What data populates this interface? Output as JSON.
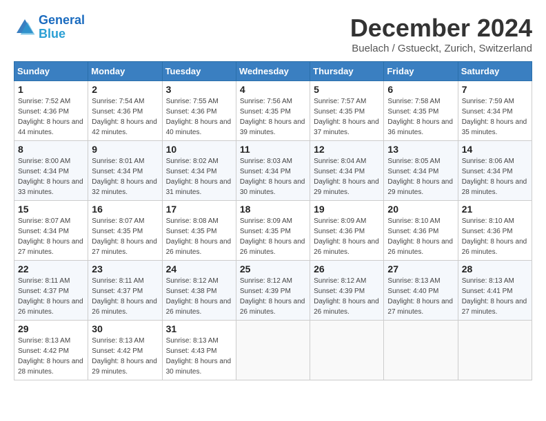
{
  "header": {
    "logo_line1": "General",
    "logo_line2": "Blue",
    "month_title": "December 2024",
    "subtitle": "Buelach / Gstueckt, Zurich, Switzerland"
  },
  "weekdays": [
    "Sunday",
    "Monday",
    "Tuesday",
    "Wednesday",
    "Thursday",
    "Friday",
    "Saturday"
  ],
  "weeks": [
    [
      {
        "day": "1",
        "sunrise": "7:52 AM",
        "sunset": "4:36 PM",
        "daylight": "8 hours and 44 minutes."
      },
      {
        "day": "2",
        "sunrise": "7:54 AM",
        "sunset": "4:36 PM",
        "daylight": "8 hours and 42 minutes."
      },
      {
        "day": "3",
        "sunrise": "7:55 AM",
        "sunset": "4:36 PM",
        "daylight": "8 hours and 40 minutes."
      },
      {
        "day": "4",
        "sunrise": "7:56 AM",
        "sunset": "4:35 PM",
        "daylight": "8 hours and 39 minutes."
      },
      {
        "day": "5",
        "sunrise": "7:57 AM",
        "sunset": "4:35 PM",
        "daylight": "8 hours and 37 minutes."
      },
      {
        "day": "6",
        "sunrise": "7:58 AM",
        "sunset": "4:35 PM",
        "daylight": "8 hours and 36 minutes."
      },
      {
        "day": "7",
        "sunrise": "7:59 AM",
        "sunset": "4:34 PM",
        "daylight": "8 hours and 35 minutes."
      }
    ],
    [
      {
        "day": "8",
        "sunrise": "8:00 AM",
        "sunset": "4:34 PM",
        "daylight": "8 hours and 33 minutes."
      },
      {
        "day": "9",
        "sunrise": "8:01 AM",
        "sunset": "4:34 PM",
        "daylight": "8 hours and 32 minutes."
      },
      {
        "day": "10",
        "sunrise": "8:02 AM",
        "sunset": "4:34 PM",
        "daylight": "8 hours and 31 minutes."
      },
      {
        "day": "11",
        "sunrise": "8:03 AM",
        "sunset": "4:34 PM",
        "daylight": "8 hours and 30 minutes."
      },
      {
        "day": "12",
        "sunrise": "8:04 AM",
        "sunset": "4:34 PM",
        "daylight": "8 hours and 29 minutes."
      },
      {
        "day": "13",
        "sunrise": "8:05 AM",
        "sunset": "4:34 PM",
        "daylight": "8 hours and 29 minutes."
      },
      {
        "day": "14",
        "sunrise": "8:06 AM",
        "sunset": "4:34 PM",
        "daylight": "8 hours and 28 minutes."
      }
    ],
    [
      {
        "day": "15",
        "sunrise": "8:07 AM",
        "sunset": "4:34 PM",
        "daylight": "8 hours and 27 minutes."
      },
      {
        "day": "16",
        "sunrise": "8:07 AM",
        "sunset": "4:35 PM",
        "daylight": "8 hours and 27 minutes."
      },
      {
        "day": "17",
        "sunrise": "8:08 AM",
        "sunset": "4:35 PM",
        "daylight": "8 hours and 26 minutes."
      },
      {
        "day": "18",
        "sunrise": "8:09 AM",
        "sunset": "4:35 PM",
        "daylight": "8 hours and 26 minutes."
      },
      {
        "day": "19",
        "sunrise": "8:09 AM",
        "sunset": "4:36 PM",
        "daylight": "8 hours and 26 minutes."
      },
      {
        "day": "20",
        "sunrise": "8:10 AM",
        "sunset": "4:36 PM",
        "daylight": "8 hours and 26 minutes."
      },
      {
        "day": "21",
        "sunrise": "8:10 AM",
        "sunset": "4:36 PM",
        "daylight": "8 hours and 26 minutes."
      }
    ],
    [
      {
        "day": "22",
        "sunrise": "8:11 AM",
        "sunset": "4:37 PM",
        "daylight": "8 hours and 26 minutes."
      },
      {
        "day": "23",
        "sunrise": "8:11 AM",
        "sunset": "4:37 PM",
        "daylight": "8 hours and 26 minutes."
      },
      {
        "day": "24",
        "sunrise": "8:12 AM",
        "sunset": "4:38 PM",
        "daylight": "8 hours and 26 minutes."
      },
      {
        "day": "25",
        "sunrise": "8:12 AM",
        "sunset": "4:39 PM",
        "daylight": "8 hours and 26 minutes."
      },
      {
        "day": "26",
        "sunrise": "8:12 AM",
        "sunset": "4:39 PM",
        "daylight": "8 hours and 26 minutes."
      },
      {
        "day": "27",
        "sunrise": "8:13 AM",
        "sunset": "4:40 PM",
        "daylight": "8 hours and 27 minutes."
      },
      {
        "day": "28",
        "sunrise": "8:13 AM",
        "sunset": "4:41 PM",
        "daylight": "8 hours and 27 minutes."
      }
    ],
    [
      {
        "day": "29",
        "sunrise": "8:13 AM",
        "sunset": "4:42 PM",
        "daylight": "8 hours and 28 minutes."
      },
      {
        "day": "30",
        "sunrise": "8:13 AM",
        "sunset": "4:42 PM",
        "daylight": "8 hours and 29 minutes."
      },
      {
        "day": "31",
        "sunrise": "8:13 AM",
        "sunset": "4:43 PM",
        "daylight": "8 hours and 30 minutes."
      },
      null,
      null,
      null,
      null
    ]
  ]
}
